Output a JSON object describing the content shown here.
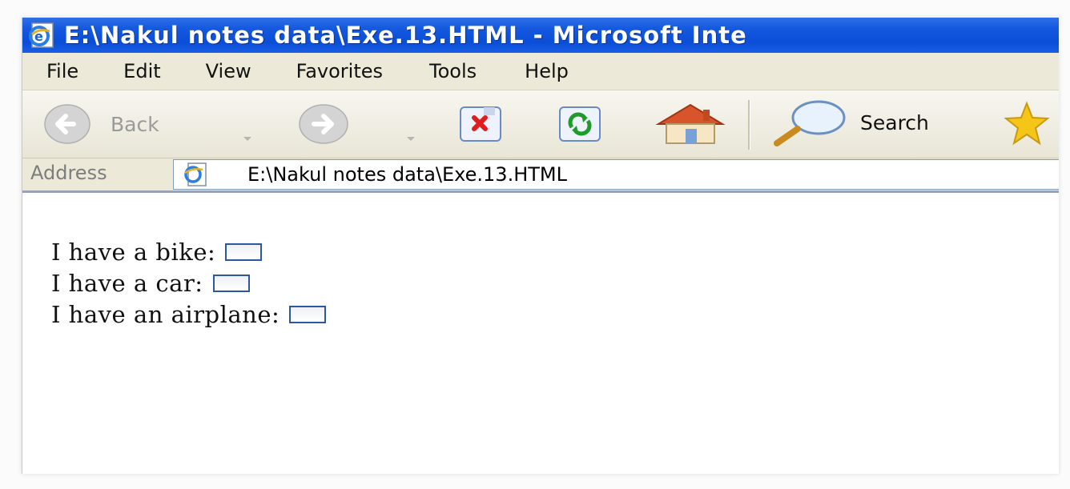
{
  "window": {
    "title": "E:\\Nakul notes data\\Exe.13.HTML - Microsoft Inte"
  },
  "menu": [
    "File",
    "Edit",
    "View",
    "Favorites",
    "Tools",
    "Help"
  ],
  "toolbar": {
    "back_label": "Back",
    "search_label": "Search"
  },
  "address": {
    "label": "Address",
    "value": "E:\\Nakul notes data\\Exe.13.HTML"
  },
  "form": {
    "items": [
      {
        "label": "I have a bike:",
        "checked": false
      },
      {
        "label": "I have a car:",
        "checked": false
      },
      {
        "label": "I have an airplane:",
        "checked": false
      }
    ]
  },
  "colors": {
    "titlebar": "#0a4ed8",
    "chrome": "#ece9d8",
    "checkbox_border": "#2b58a0"
  },
  "icons": [
    "ie-page-icon",
    "back-arrow-icon",
    "forward-arrow-icon",
    "stop-icon",
    "refresh-icon",
    "home-icon",
    "search-magnifier-icon",
    "favorites-star-icon"
  ]
}
